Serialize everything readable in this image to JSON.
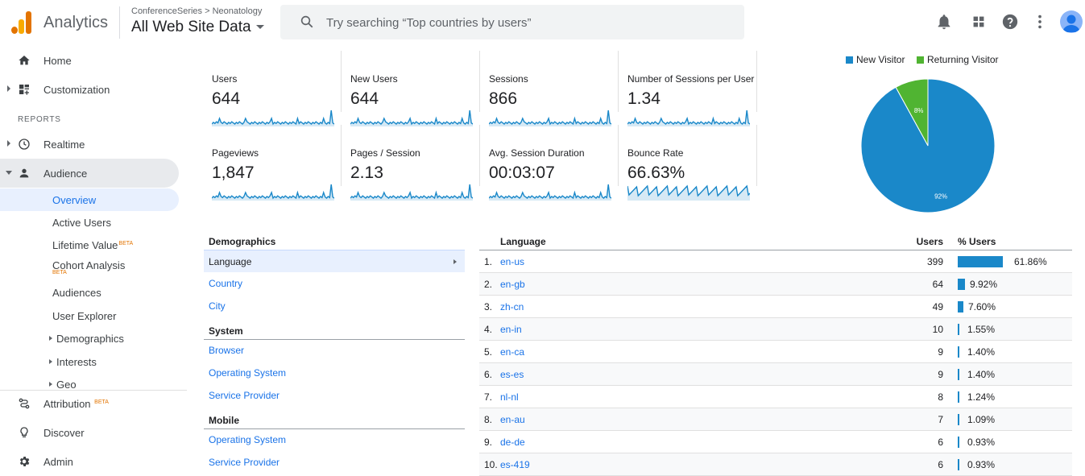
{
  "header": {
    "app_name": "Analytics",
    "breadcrumb": "ConferenceSeries > Neonatology",
    "property": "All Web Site Data",
    "search_placeholder": "Try searching “Top countries by users”",
    "icons": [
      "notifications-icon",
      "apps-grid-icon",
      "help-icon",
      "more-vert-icon",
      "account-avatar"
    ]
  },
  "sidebar": {
    "items": [
      {
        "label": "Home",
        "icon": "home-icon"
      },
      {
        "label": "Customization",
        "icon": "dashboard-icon"
      }
    ],
    "reports_header": "REPORTS",
    "reports": [
      {
        "label": "Realtime",
        "icon": "clock-icon"
      },
      {
        "label": "Audience",
        "icon": "person-icon"
      }
    ],
    "audience_sub": [
      {
        "label": "Overview"
      },
      {
        "label": "Active Users"
      },
      {
        "label": "Lifetime Value",
        "badge": "BETA"
      },
      {
        "label": "Cohort Analysis",
        "badge": "BETA"
      },
      {
        "label": "Audiences"
      },
      {
        "label": "User Explorer"
      },
      {
        "label": "Demographics"
      },
      {
        "label": "Interests"
      },
      {
        "label": "Geo"
      }
    ],
    "bottom": [
      {
        "label": "Attribution",
        "badge": "BETA",
        "icon": "attribution-icon"
      },
      {
        "label": "Discover",
        "icon": "lightbulb-icon"
      },
      {
        "label": "Admin",
        "icon": "gear-icon"
      }
    ]
  },
  "metrics": [
    {
      "name": "Users",
      "value": "644"
    },
    {
      "name": "New Users",
      "value": "644"
    },
    {
      "name": "Sessions",
      "value": "866"
    },
    {
      "name": "Number of Sessions per User",
      "value": "1.34"
    },
    {
      "name": "Pageviews",
      "value": "1,847"
    },
    {
      "name": "Pages / Session",
      "value": "2.13"
    },
    {
      "name": "Avg. Session Duration",
      "value": "00:03:07"
    },
    {
      "name": "Bounce Rate",
      "value": "66.63%"
    }
  ],
  "chart_data": {
    "type": "pie",
    "labels": [
      "New Visitor",
      "Returning Visitor"
    ],
    "values": [
      92,
      8
    ],
    "slice_labels": [
      "92%",
      "8%"
    ],
    "colors": [
      "#1a88c9",
      "#50b432"
    ],
    "legend": "top"
  },
  "demographics": {
    "sections": [
      {
        "header": "Demographics",
        "items": [
          "Language",
          "Country",
          "City"
        ]
      },
      {
        "header": "System",
        "items": [
          "Browser",
          "Operating System",
          "Service Provider"
        ]
      },
      {
        "header": "Mobile",
        "items": [
          "Operating System",
          "Service Provider"
        ]
      }
    ]
  },
  "table": {
    "headers": {
      "language": "Language",
      "users": "Users",
      "pct_users": "% Users"
    },
    "rows": [
      {
        "idx": "1.",
        "lang": "en-us",
        "users": "399",
        "pct": "61.86%",
        "share": 61.86
      },
      {
        "idx": "2.",
        "lang": "en-gb",
        "users": "64",
        "pct": "9.92%",
        "share": 9.92
      },
      {
        "idx": "3.",
        "lang": "zh-cn",
        "users": "49",
        "pct": "7.60%",
        "share": 7.6
      },
      {
        "idx": "4.",
        "lang": "en-in",
        "users": "10",
        "pct": "1.55%",
        "share": 1.55
      },
      {
        "idx": "5.",
        "lang": "en-ca",
        "users": "9",
        "pct": "1.40%",
        "share": 1.4
      },
      {
        "idx": "6.",
        "lang": "es-es",
        "users": "9",
        "pct": "1.40%",
        "share": 1.4
      },
      {
        "idx": "7.",
        "lang": "nl-nl",
        "users": "8",
        "pct": "1.24%",
        "share": 1.24
      },
      {
        "idx": "8.",
        "lang": "en-au",
        "users": "7",
        "pct": "1.09%",
        "share": 1.09
      },
      {
        "idx": "9.",
        "lang": "de-de",
        "users": "6",
        "pct": "0.93%",
        "share": 0.93
      },
      {
        "idx": "10.",
        "lang": "es-419",
        "users": "6",
        "pct": "0.93%",
        "share": 0.93
      }
    ]
  }
}
